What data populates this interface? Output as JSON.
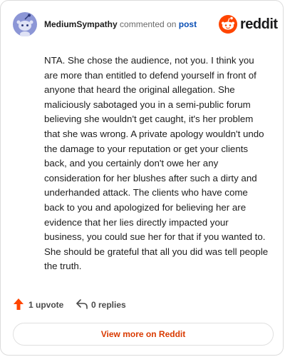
{
  "header": {
    "username": "MediumSympathy",
    "action": "commented on",
    "target": "post",
    "brand_name": "reddit"
  },
  "comment": {
    "text": "NTA. She chose the audience, not you. I think you are more than entitled to defend yourself in front of anyone that heard the original allegation. She maliciously sabotaged you in a semi-public forum believing she wouldn't get caught, it's her problem that she was wrong. A private apology wouldn't undo the damage to your reputation or get your clients back, and you certainly don't owe her any consideration for her blushes after such a dirty and underhanded attack. The clients who have come back to you and apologized for believing her are evidence that her lies directly impacted your business, you could sue her for that if you wanted to. She should be grateful that all you did was tell people the truth."
  },
  "actions": {
    "upvote_label": "1 upvote",
    "replies_label": "0 replies"
  },
  "footer": {
    "view_more_label": "View more on Reddit"
  },
  "colors": {
    "brand": "#ff4500",
    "accent_link": "#0a4fb5",
    "view_more": "#d93a00",
    "avatar": "#8c96d6"
  },
  "icons": {
    "avatar": "snoo-avatar-icon",
    "brand": "reddit-logo-icon",
    "upvote": "upvote-arrow-icon",
    "reply": "reply-arrow-icon"
  }
}
